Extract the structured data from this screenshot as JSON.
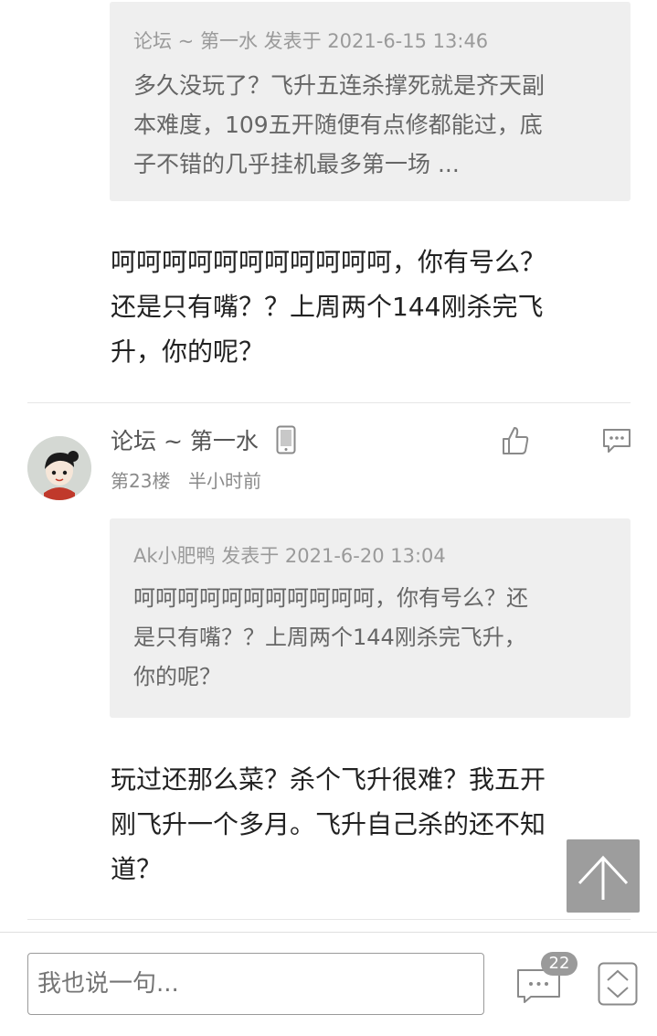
{
  "quote1": {
    "meta": "论坛 ~ 第一水 发表于 2021-6-15 13:46",
    "lines": [
      "多久没玩了？飞升五连杀撑死就是齐天副",
      "本难度，109五开随便有点修都能过，底",
      "子不错的几乎挂机最多第一场 ..."
    ]
  },
  "reply1": {
    "lines": [
      "呵呵呵呵呵呵呵呵呵呵呵，你有号么？",
      "还是只有嘴？？上周两个144刚杀完飞",
      "升，你的呢？"
    ]
  },
  "post": {
    "author": "论坛 ~ 第一水",
    "floor": "第23楼",
    "time": "半小时前",
    "icons": {
      "device": "mobile-phone-icon",
      "like": "thumbs-up-icon",
      "comment": "comment-icon"
    }
  },
  "quote2": {
    "meta": "Ak小肥鸭 发表于 2021-6-20 13:04",
    "lines": [
      "呵呵呵呵呵呵呵呵呵呵呵，你有号么？还",
      "是只有嘴？？上周两个144刚杀完飞升，",
      "你的呢？"
    ]
  },
  "reply2": {
    "lines": [
      "玩过还那么菜？杀个飞升很难？我五开",
      "刚飞升一个多月。飞升自己杀的还不知",
      "道？"
    ]
  },
  "bottom": {
    "placeholder": "我也说一句...",
    "comment_count": "22"
  },
  "colors": {
    "quote_bg": "#efefef",
    "badge": "#9a9a9a",
    "scroll_btn": "#8c8c8c"
  }
}
